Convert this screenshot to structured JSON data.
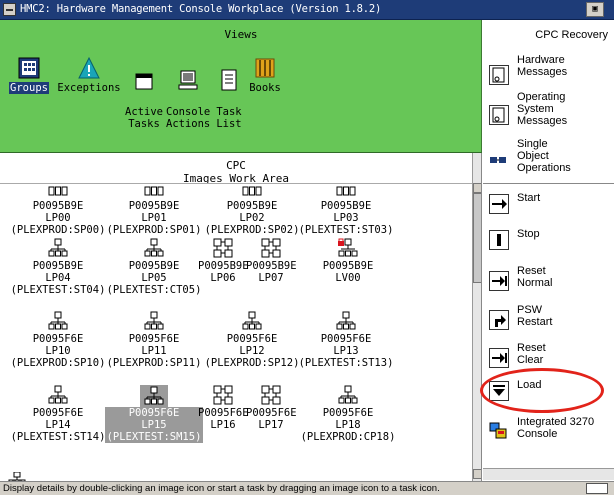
{
  "window": {
    "title": "HMC2: Hardware Management Console Workplace (Version 1.8.2)",
    "minimize_glyph": "▣"
  },
  "views": {
    "title": "Views",
    "items": [
      {
        "label": "Groups",
        "icon": "groups-icon",
        "selected": true
      },
      {
        "label": "Exceptions",
        "icon": "exceptions-icon"
      },
      {
        "label": "Active\nTasks",
        "icon": "active-tasks-icon"
      },
      {
        "label": "Console\nActions",
        "icon": "console-actions-icon"
      },
      {
        "label": "Task\nList",
        "icon": "task-list-icon"
      },
      {
        "label": "Books",
        "icon": "books-icon"
      }
    ]
  },
  "work_area": {
    "title_line1": "CPC",
    "title_line2": "Images Work Area",
    "rows": [
      [
        {
          "name": "P0095B9E",
          "part": "LP00",
          "prof": "(PLEXPROD:SP00)"
        },
        {
          "name": "P0095B9E",
          "part": "LP01",
          "prof": "(PLEXPROD:SP01)"
        },
        {
          "name": "P0095B9E",
          "part": "LP02",
          "prof": "(PLEXPROD:SP02)"
        },
        {
          "name": "P0095B9E",
          "part": "LP03",
          "prof": "(PLEXTEST:ST03)"
        }
      ],
      [
        {
          "name": "P0095B9E",
          "part": "LP04",
          "prof": "(PLEXTEST:ST04)"
        },
        {
          "name": "P0095B9E",
          "part": "LP05",
          "prof": "(PLEXTEST:CT05)"
        },
        {
          "name": "P0095B9E",
          "part": "LP06",
          "prof": ""
        },
        {
          "name": "P0095B9E",
          "part": "LP07",
          "prof": ""
        },
        {
          "name": "P0095B9E",
          "part": "LV00",
          "prof": ""
        }
      ],
      [
        {
          "name": "P0095F6E",
          "part": "LP10",
          "prof": "(PLEXPROD:SP10)"
        },
        {
          "name": "P0095F6E",
          "part": "LP11",
          "prof": "(PLEXPROD:SP11)"
        },
        {
          "name": "P0095F6E",
          "part": "LP12",
          "prof": "(PLEXPROD:SP12)"
        },
        {
          "name": "P0095F6E",
          "part": "LP13",
          "prof": "(PLEXTEST:ST13)"
        }
      ],
      [
        {
          "name": "P0095F6E",
          "part": "LP14",
          "prof": "(PLEXTEST:ST14)"
        },
        {
          "name": "P0095F6E",
          "part": "LP15",
          "prof": "(PLEXTEST:SM15)",
          "selected": true
        },
        {
          "name": "P0095F6E",
          "part": "LP16",
          "prof": ""
        },
        {
          "name": "P0095F6E",
          "part": "LP17",
          "prof": ""
        },
        {
          "name": "P0095F6E",
          "part": "LP18",
          "prof": "(PLEXPROD:CP18)"
        }
      ]
    ]
  },
  "tasks": {
    "title": "CPC Recovery",
    "items": [
      {
        "label": "Hardware\nMessages",
        "icon": "hardware-messages-icon"
      },
      {
        "label": "Operating\nSystem\nMessages",
        "icon": "os-messages-icon"
      },
      {
        "label": "Single\nObject\nOperations",
        "icon": "single-object-operations-icon"
      },
      {
        "label": "Start",
        "icon": "start-icon"
      },
      {
        "label": "Stop",
        "icon": "stop-icon"
      },
      {
        "label": "Reset\nNormal",
        "icon": "reset-normal-icon"
      },
      {
        "label": "PSW\nRestart",
        "icon": "psw-restart-icon"
      },
      {
        "label": "Reset\nClear",
        "icon": "reset-clear-icon"
      },
      {
        "label": "Load",
        "icon": "load-icon"
      },
      {
        "label": "Integrated 3270\nConsole",
        "icon": "integrated-3270-console-icon"
      }
    ]
  },
  "status_bar": {
    "message": "Display details by double-clicking an image icon or start a task by dragging an image icon to a task icon."
  },
  "colors": {
    "views_bg": "#67c657",
    "title_bg": "#1e3c78",
    "annotation": "#e2231a"
  }
}
